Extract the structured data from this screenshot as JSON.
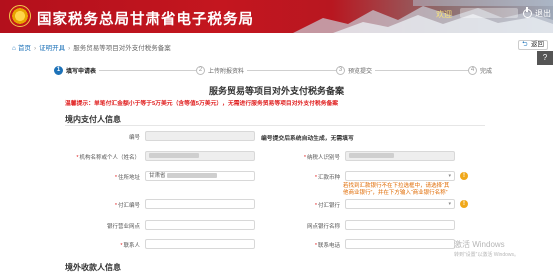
{
  "header": {
    "site_title": "国家税务总局甘肃省电子税务局",
    "welcome": "欢迎",
    "logout": "退出"
  },
  "utility": {
    "back": "返回",
    "qr": "?"
  },
  "breadcrumb": {
    "home": "首页",
    "level1": "证明开具",
    "level2": "服务贸易等项目对外支付税务备案"
  },
  "steps": [
    {
      "num": "1",
      "label": "填写申请表"
    },
    {
      "num": "2",
      "label": "上传附报资料"
    },
    {
      "num": "3",
      "label": "预览提交"
    },
    {
      "num": "4",
      "label": "完成"
    }
  ],
  "form": {
    "title": "服务贸易等项目对外支付税务备案",
    "notice": "温馨提示：单笔付汇金额小于等于5万美元（含等值5万美元），无需进行服务贸易等项目对外支付税务备案",
    "section_domestic": "境内支付人信息",
    "section_overseas": "境外收款人信息",
    "record_no_label": "编号",
    "record_no_hint": "编号提交后系统自动生成，无需填写",
    "fields": {
      "taxpayer_name": "机构名称或个人（姓名）",
      "taxpayer_id": "纳税人识别号",
      "address": "住所地址",
      "address_prefix": "甘肃省",
      "currency": "汇款币种",
      "contract_no": "付汇编号",
      "bank_name": "付汇银行",
      "branch": "银行营业网点",
      "branch_code": "网点银行名称",
      "contact": "联系人",
      "phone": "联系电话"
    },
    "bank_help": "若找到汇款银行不在下拉选框中，请选择“其他商业银行”，并在下方输入“商业银行名称”"
  },
  "watermark": {
    "line1": "激活 Windows",
    "line2": "转到“设置”以激活 Windows。"
  }
}
